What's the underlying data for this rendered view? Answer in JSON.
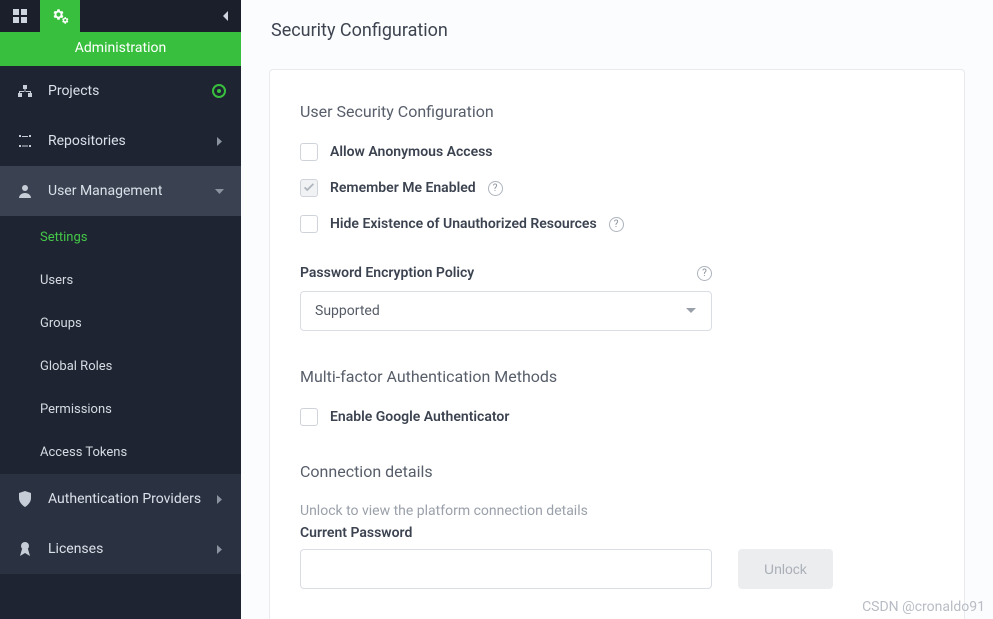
{
  "topbar": {
    "title": "Administration"
  },
  "sidebar": {
    "items": [
      {
        "label": "Projects",
        "icon": "projects-icon",
        "trailing": "ring"
      },
      {
        "label": "Repositories",
        "icon": "repositories-icon",
        "trailing": "caret-right"
      },
      {
        "label": "User Management",
        "icon": "user-icon",
        "trailing": "caret-down",
        "selected": true,
        "children": [
          {
            "label": "Settings",
            "active": true
          },
          {
            "label": "Users"
          },
          {
            "label": "Groups"
          },
          {
            "label": "Global Roles"
          },
          {
            "label": "Permissions"
          },
          {
            "label": "Access Tokens"
          }
        ]
      },
      {
        "label": "Authentication Providers",
        "icon": "shield-icon",
        "trailing": "caret-right",
        "dim": true
      },
      {
        "label": "Licenses",
        "icon": "medal-icon",
        "trailing": "caret-right",
        "dim": true
      }
    ]
  },
  "page": {
    "title": "Security Configuration",
    "user_security": {
      "heading": "User Security Configuration",
      "allow_anonymous_label": "Allow Anonymous Access",
      "allow_anonymous_checked": false,
      "remember_me_label": "Remember Me Enabled",
      "remember_me_checked": true,
      "hide_unauth_label": "Hide Existence of Unauthorized Resources",
      "hide_unauth_checked": false,
      "password_policy_label": "Password Encryption Policy",
      "password_policy_value": "Supported"
    },
    "mfa": {
      "heading": "Multi-factor Authentication Methods",
      "google_auth_label": "Enable Google Authenticator",
      "google_auth_checked": false
    },
    "connection": {
      "heading": "Connection details",
      "hint": "Unlock to view the platform connection details",
      "password_label": "Current Password",
      "password_value": "",
      "unlock_label": "Unlock"
    }
  },
  "watermark": "CSDN @cronaldo91"
}
